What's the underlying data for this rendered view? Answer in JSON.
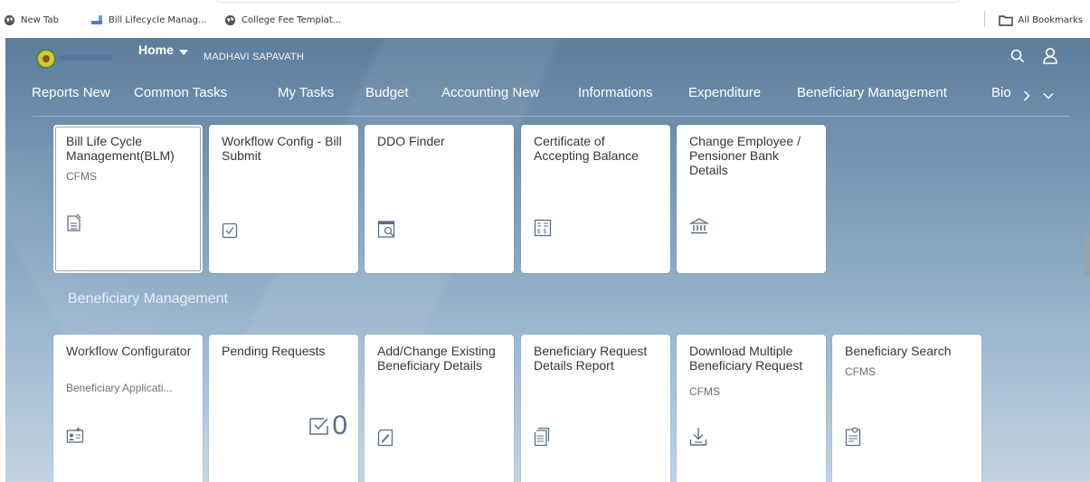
{
  "bookmarks": {
    "items": [
      {
        "label": "New Tab",
        "icon": "globe-icon"
      },
      {
        "label": "Bill Lifecycle Manag...",
        "icon": "app-icon"
      },
      {
        "label": "College Fee Templat...",
        "icon": "globe-icon"
      }
    ],
    "all_label": "All Bookmarks"
  },
  "header": {
    "home_label": "Home",
    "user_name": "MADHAVI SAPAVATH"
  },
  "nav": {
    "items": [
      "Reports New",
      "Common Tasks",
      "My Tasks",
      "Budget",
      "Accounting New",
      "Informations",
      "Expenditure",
      "Beneficiary Management",
      "Bio"
    ]
  },
  "top_tiles": [
    {
      "title": "Bill Life Cycle Management(BLM)",
      "subtitle": "CFMS",
      "icon": "document-edit-icon"
    },
    {
      "title": "Workflow Config - Bill Submit",
      "subtitle": "",
      "icon": "checkbox-document-icon"
    },
    {
      "title": "DDO Finder",
      "subtitle": "",
      "icon": "calendar-search-icon"
    },
    {
      "title": "Certificate of Accepting Balance",
      "subtitle": "",
      "icon": "currency-sheet-icon"
    },
    {
      "title": "Change Employee / Pensioner Bank Details",
      "subtitle": "",
      "icon": "bank-icon"
    }
  ],
  "section": {
    "title": "Beneficiary Management"
  },
  "bottom_tiles": [
    {
      "title": "Workflow Configurator",
      "subtitle": "Beneficiary Applicati...",
      "icon": "add-contact-icon"
    },
    {
      "title": "Pending Requests",
      "subtitle": "",
      "icon": "inbox-check-icon",
      "count": "0"
    },
    {
      "title": "Add/Change Existing Beneficiary Details",
      "subtitle": "",
      "icon": "edit-document-icon"
    },
    {
      "title": "Beneficiary Request Details Report",
      "subtitle": "",
      "icon": "report-icon"
    },
    {
      "title": "Download Multiple Beneficiary Request",
      "subtitle": "CFMS",
      "icon": "download-icon"
    },
    {
      "title": "Beneficiary Search",
      "subtitle": "CFMS",
      "icon": "document-search-icon"
    }
  ]
}
